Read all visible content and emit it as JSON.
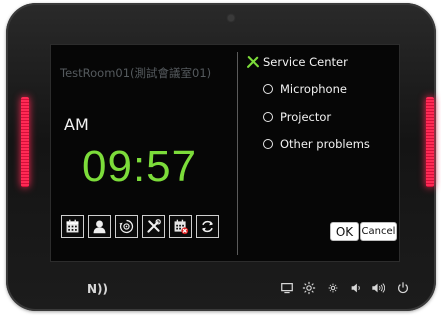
{
  "room": {
    "name": "TestRoom01(測試會議室01)"
  },
  "clock": {
    "ampm": "AM",
    "time": "09:57"
  },
  "service": {
    "title": "Service Center",
    "options": [
      {
        "label": "Microphone",
        "selected": false
      },
      {
        "label": "Projector",
        "selected": false
      },
      {
        "label": "Other problems",
        "selected": false
      }
    ],
    "ok_label": "OK",
    "cancel_label": "Cancel"
  },
  "toolbar": {
    "icons": [
      "calendar-icon",
      "user-icon",
      "settings-sync-icon",
      "tools-icon",
      "calendar-cancel-icon",
      "refresh-icon"
    ]
  },
  "bottom_bar": {
    "nfc_label": "N))",
    "icons": [
      "monitor-icon",
      "brightness-up-icon",
      "brightness-down-icon",
      "volume-down-icon",
      "volume-up-icon",
      "power-icon"
    ]
  },
  "colors": {
    "clock": "#7cdc3a",
    "led": "#ff2a55",
    "service_icon": "#7cdc3a",
    "cancel_mark": "#e02020"
  }
}
